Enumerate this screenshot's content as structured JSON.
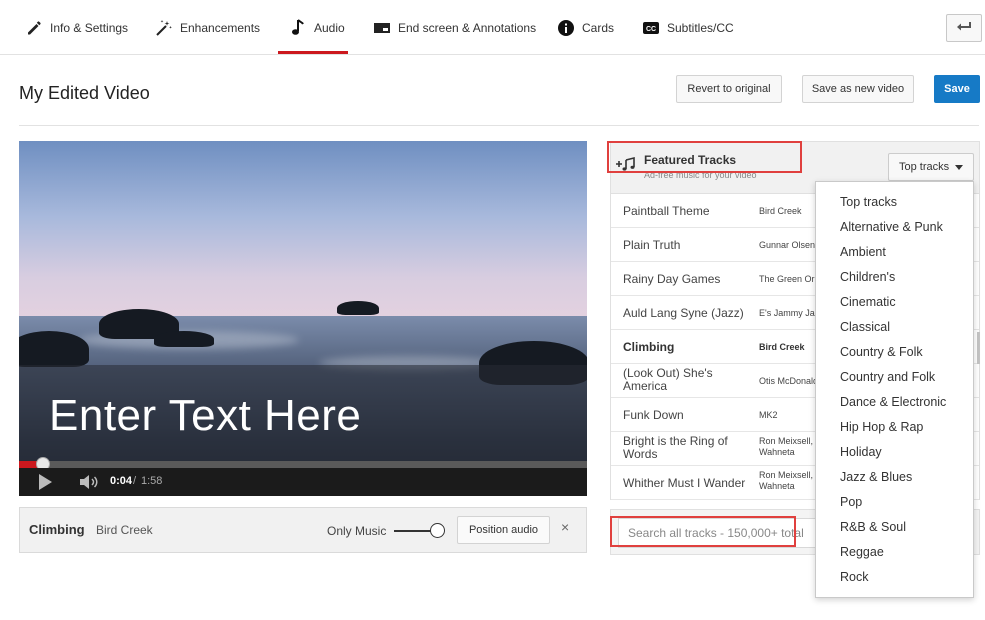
{
  "tabs": [
    {
      "label": "Info & Settings",
      "icon": "pencil-icon"
    },
    {
      "label": "Enhancements",
      "icon": "magic-wand-icon"
    },
    {
      "label": "Audio",
      "icon": "music-note-icon",
      "active": true
    },
    {
      "label": "End screen & Annotations",
      "icon": "end-screen-icon"
    },
    {
      "label": "Cards",
      "icon": "info-icon"
    },
    {
      "label": "Subtitles/CC",
      "icon": "cc-icon"
    }
  ],
  "page": {
    "title": "My Edited Video",
    "revert_label": "Revert to original",
    "save_new_label": "Save as new video",
    "save_label": "Save"
  },
  "video": {
    "overlay_text": "Enter Text Here",
    "current_time": "0:04",
    "separator": "/",
    "duration": "1:58",
    "progress_fraction": 0.034
  },
  "selected_track": {
    "title": "Climbing",
    "artist": "Bird Creek",
    "mix_label": "Only Music",
    "position_label": "Position audio",
    "close_symbol": "×"
  },
  "featured": {
    "title": "Featured Tracks",
    "subtitle": "Ad-free music for your video",
    "filter_label": "Top tracks",
    "tracks": [
      {
        "name": "Paintball Theme",
        "artist": "Bird Creek"
      },
      {
        "name": "Plain Truth",
        "artist": "Gunnar Olsen"
      },
      {
        "name": "Rainy Day Games",
        "artist": "The Green Orbs"
      },
      {
        "name": "Auld Lang Syne (Jazz)",
        "artist": "E's Jammy Jams"
      },
      {
        "name": "Climbing",
        "artist": "Bird Creek",
        "selected": true
      },
      {
        "name": "(Look Out) She's America",
        "artist": "Otis McDonald"
      },
      {
        "name": "Funk Down",
        "artist": "MK2"
      },
      {
        "name": "Bright is the Ring of Words",
        "artist": "Ron Meixsell, Wahneta Meixsell"
      },
      {
        "name": "Whither Must I Wander",
        "artist": "Ron Meixsell, Wahneta Meixsell"
      }
    ]
  },
  "search": {
    "placeholder": "Search all tracks - 150,000+ total"
  },
  "genre_menu": [
    "Top tracks",
    "Alternative & Punk",
    "Ambient",
    "Children's",
    "Cinematic",
    "Classical",
    "Country & Folk",
    "Country and Folk",
    "Dance & Electronic",
    "Hip Hop & Rap",
    "Holiday",
    "Jazz & Blues",
    "Pop",
    "R&B & Soul",
    "Reggae",
    "Rock"
  ],
  "colors": {
    "accent_red": "#cc181e",
    "save_blue": "#167ac6",
    "highlight_red": "#e0403e"
  }
}
